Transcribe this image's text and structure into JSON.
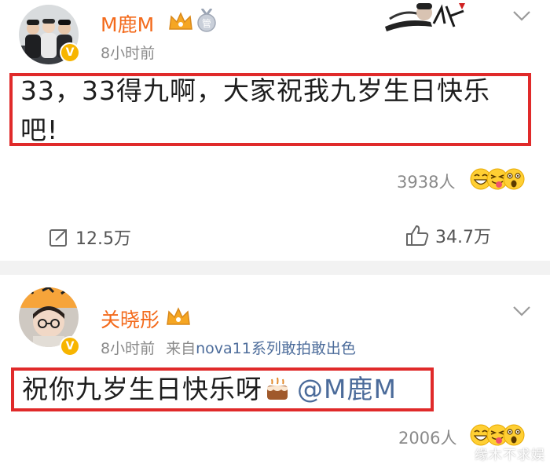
{
  "post": {
    "username": "M鹿M",
    "time": "8小时前",
    "text": "33，33得九啊，大家祝我九岁生日快乐吧!",
    "likes_count": "3938人",
    "repost_count": "12.5万",
    "like_count": "34.7万",
    "medal_label": "管"
  },
  "comment": {
    "username": "关晓彤",
    "time": "8小时前",
    "source_label": "来自",
    "source_value": "nova11系列敢拍敢出色",
    "text": "祝你九岁生日快乐呀",
    "mention": "@M鹿M",
    "likes_count": "2006人"
  },
  "watermark": "缘木不求娱",
  "colors": {
    "username": "#f36a1b",
    "highlight_border": "#e02a2a",
    "link": "#4b6b9a",
    "verify_badge": "#f7b500",
    "crown": "#f5a623"
  },
  "icons": [
    "crown-icon",
    "medal-icon",
    "verified-icon",
    "chevron-down-icon",
    "repost-icon",
    "thumbs-up-icon",
    "grinning-emoji-icon",
    "tongue-emoji-icon",
    "surprised-emoji-icon",
    "cake-emoji-icon"
  ]
}
